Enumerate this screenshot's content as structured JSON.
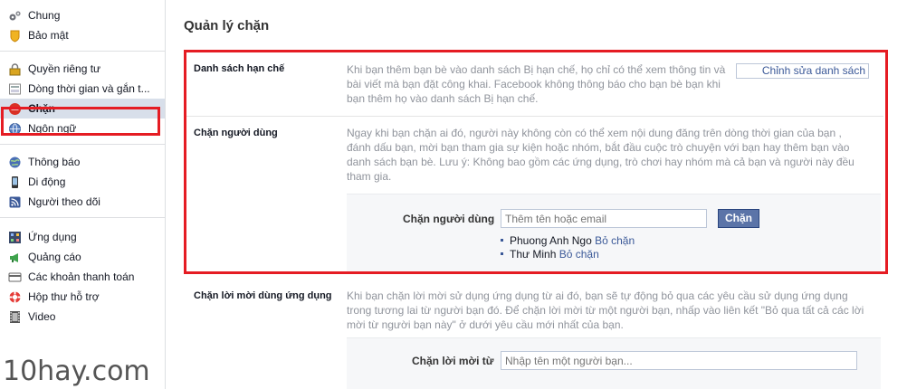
{
  "sidebar": {
    "groups": [
      [
        {
          "label": "Chung",
          "icon": "gears-icon"
        },
        {
          "label": "Bảo mật",
          "icon": "badge-icon"
        }
      ],
      [
        {
          "label": "Quyền riêng tư",
          "icon": "lock-icon"
        },
        {
          "label": "Dòng thời gian và gắn t...",
          "icon": "timeline-icon"
        },
        {
          "label": "Chặn",
          "icon": "block-icon",
          "active": true
        },
        {
          "label": "Ngôn ngữ",
          "icon": "globe-icon"
        }
      ],
      [
        {
          "label": "Thông báo",
          "icon": "globe-notify-icon"
        },
        {
          "label": "Di động",
          "icon": "mobile-icon"
        },
        {
          "label": "Người theo dõi",
          "icon": "rss-icon"
        }
      ],
      [
        {
          "label": "Ứng dụng",
          "icon": "apps-icon"
        },
        {
          "label": "Quảng cáo",
          "icon": "ads-icon"
        },
        {
          "label": "Các khoản thanh toán",
          "icon": "card-icon"
        },
        {
          "label": "Hộp thư hỗ trợ",
          "icon": "lifebuoy-icon"
        },
        {
          "label": "Video",
          "icon": "film-icon"
        }
      ]
    ]
  },
  "main": {
    "title": "Quản lý chặn",
    "restricted": {
      "label": "Danh sách hạn chế",
      "description": "Khi bạn thêm bạn bè vào danh sách Bị hạn chế, họ chỉ có thể xem thông tin và bài viết mà bạn đặt công khai. Facebook không thông báo cho bạn bè bạn khi bạn thêm họ vào danh sách Bị hạn chế.",
      "edit_label": "Chỉnh sửa danh sách"
    },
    "block_users": {
      "label": "Chặn người dùng",
      "description": "Ngay khi bạn chặn ai đó, người này không còn có thể xem nội dung đăng trên dòng thời gian của bạn , đánh dấu bạn, mời bạn tham gia sự kiện hoặc nhóm, bắt đầu cuộc trò chuyện với bạn hay thêm bạn vào danh sách bạn bè. Lưu ý: Không bao gồm các ứng dụng, trò chơi hay nhóm mà cả bạn và người này đều tham gia.",
      "input_label": "Chặn người dùng",
      "input_placeholder": "Thêm tên hoặc email",
      "button_label": "Chặn",
      "blocked": [
        {
          "name": "Phuong Anh Ngo",
          "unblock": "Bỏ chặn"
        },
        {
          "name": "Thư Minh",
          "unblock": "Bỏ chặn"
        }
      ]
    },
    "block_app_invites": {
      "label": "Chặn lời mời dùng ứng dụng",
      "description": "Khi bạn chặn lời mời sử dụng ứng dụng từ ai đó, bạn sẽ tự động bỏ qua các yêu cầu sử dụng ứng dụng trong tương lai từ người bạn đó. Để chặn lời mời từ một người bạn, nhấp vào liên kết \"Bỏ qua tất cả các lời mời từ người bạn này\" ở dưới yêu cầu mới nhất của bạn.",
      "input_label": "Chặn lời mời từ",
      "input_placeholder": "Nhập tên một người bạn..."
    }
  },
  "watermark": "10hay.com",
  "colors": {
    "highlight": "#e51c23",
    "link": "#3b5998",
    "active_bg": "#d8dfea"
  }
}
